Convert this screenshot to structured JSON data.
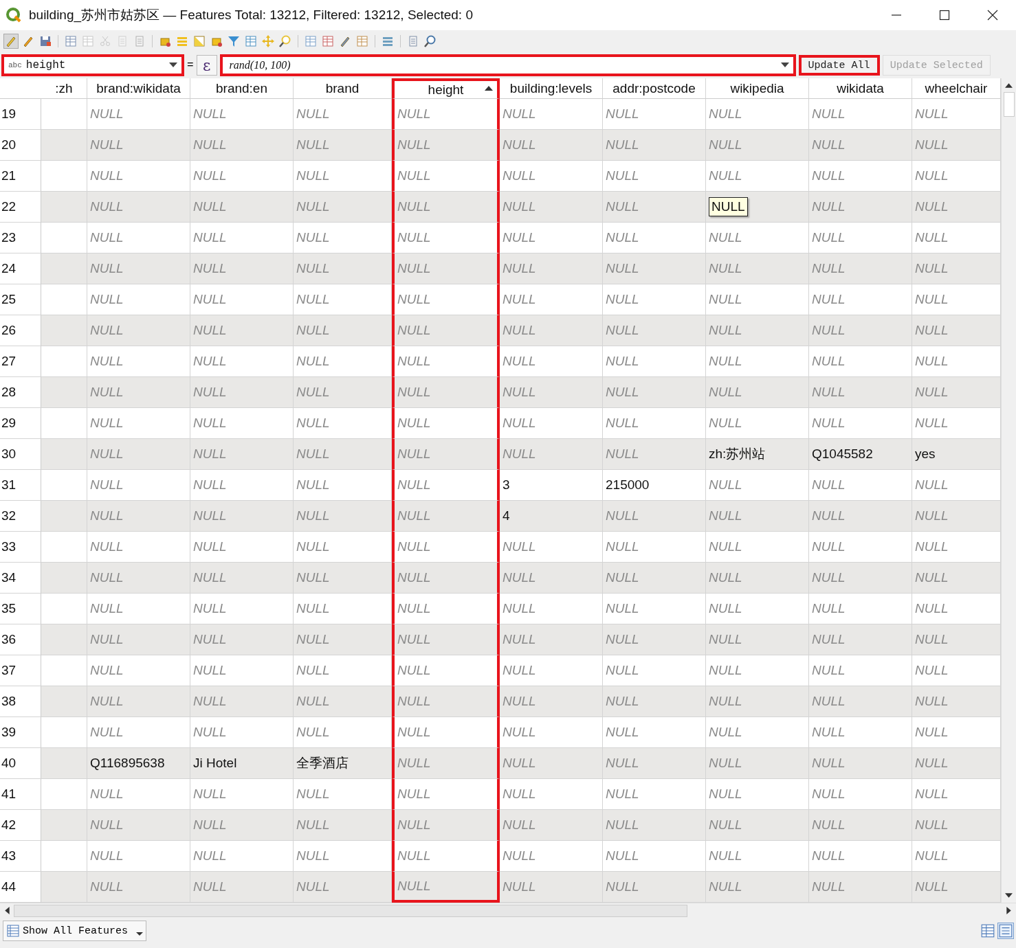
{
  "window": {
    "title": "building_苏州市姑苏区 — Features Total: 13212, Filtered: 13212, Selected: 0"
  },
  "field_calculator": {
    "field": {
      "type_label": "abc",
      "value": "height",
      "highlighted": true
    },
    "equals": "=",
    "expression_button": "ε",
    "expression": {
      "value": "rand(10, 100)",
      "highlighted": true
    },
    "buttons": [
      {
        "label": "Update All",
        "disabled": false,
        "highlighted": true
      },
      {
        "label": "Update Selected",
        "disabled": true,
        "highlighted": false
      }
    ]
  },
  "table": {
    "columns": [
      {
        "label": ":zh",
        "sorted": false,
        "highlighted": false
      },
      {
        "label": "brand:wikidata",
        "sorted": false,
        "highlighted": false
      },
      {
        "label": "brand:en",
        "sorted": false,
        "highlighted": false
      },
      {
        "label": "brand",
        "sorted": false,
        "highlighted": false
      },
      {
        "label": "height",
        "sorted": true,
        "highlighted": true
      },
      {
        "label": "building:levels",
        "sorted": false,
        "highlighted": false
      },
      {
        "label": "addr:postcode",
        "sorted": false,
        "highlighted": false
      },
      {
        "label": "wikipedia",
        "sorted": false,
        "highlighted": false
      },
      {
        "label": "wikidata",
        "sorted": false,
        "highlighted": false
      },
      {
        "label": "wheelchair",
        "sorted": false,
        "highlighted": false
      }
    ],
    "rows": [
      {
        "id": "19",
        "cells": [
          "",
          {
            "text": "NULL",
            "null": true
          },
          {
            "text": "NULL",
            "null": true
          },
          {
            "text": "NULL",
            "null": true
          },
          {
            "text": "NULL",
            "null": true
          },
          {
            "text": "NULL",
            "null": true
          },
          {
            "text": "NULL",
            "null": true
          },
          {
            "text": "NULL",
            "null": true
          },
          {
            "text": "NULL",
            "null": true
          },
          {
            "text": "NULL",
            "null": true
          }
        ]
      },
      {
        "id": "20",
        "cells": [
          "",
          {
            "text": "NULL",
            "null": true
          },
          {
            "text": "NULL",
            "null": true
          },
          {
            "text": "NULL",
            "null": true
          },
          {
            "text": "NULL",
            "null": true
          },
          {
            "text": "NULL",
            "null": true
          },
          {
            "text": "NULL",
            "null": true
          },
          {
            "text": "NULL",
            "null": true
          },
          {
            "text": "NULL",
            "null": true
          },
          {
            "text": "NULL",
            "null": true
          }
        ]
      },
      {
        "id": "21",
        "cells": [
          "",
          {
            "text": "NULL",
            "null": true
          },
          {
            "text": "NULL",
            "null": true
          },
          {
            "text": "NULL",
            "null": true
          },
          {
            "text": "NULL",
            "null": true
          },
          {
            "text": "NULL",
            "null": true
          },
          {
            "text": "NULL",
            "null": true
          },
          {
            "text": "NULL",
            "null": true
          },
          {
            "text": "NULL",
            "null": true
          },
          {
            "text": "NULL",
            "null": true
          }
        ]
      },
      {
        "id": "22",
        "cells": [
          "",
          {
            "text": "NULL",
            "null": true
          },
          {
            "text": "NULL",
            "null": true
          },
          {
            "text": "NULL",
            "null": true
          },
          {
            "text": "NULL",
            "null": true
          },
          {
            "text": "NULL",
            "null": true
          },
          {
            "text": "NULL",
            "null": true
          },
          {
            "kind": "tooltip",
            "text": "NULL"
          },
          {
            "text": "NULL",
            "null": true
          },
          {
            "text": "NULL",
            "null": true
          }
        ]
      },
      {
        "id": "23",
        "cells": [
          "",
          {
            "text": "NULL",
            "null": true
          },
          {
            "text": "NULL",
            "null": true
          },
          {
            "text": "NULL",
            "null": true
          },
          {
            "text": "NULL",
            "null": true
          },
          {
            "text": "NULL",
            "null": true
          },
          {
            "text": "NULL",
            "null": true
          },
          {
            "text": "NULL",
            "null": true
          },
          {
            "text": "NULL",
            "null": true
          },
          {
            "text": "NULL",
            "null": true
          }
        ]
      },
      {
        "id": "24",
        "cells": [
          "",
          {
            "text": "NULL",
            "null": true
          },
          {
            "text": "NULL",
            "null": true
          },
          {
            "text": "NULL",
            "null": true
          },
          {
            "text": "NULL",
            "null": true
          },
          {
            "text": "NULL",
            "null": true
          },
          {
            "text": "NULL",
            "null": true
          },
          {
            "text": "NULL",
            "null": true
          },
          {
            "text": "NULL",
            "null": true
          },
          {
            "text": "NULL",
            "null": true
          }
        ]
      },
      {
        "id": "25",
        "cells": [
          "",
          {
            "text": "NULL",
            "null": true
          },
          {
            "text": "NULL",
            "null": true
          },
          {
            "text": "NULL",
            "null": true
          },
          {
            "text": "NULL",
            "null": true
          },
          {
            "text": "NULL",
            "null": true
          },
          {
            "text": "NULL",
            "null": true
          },
          {
            "text": "NULL",
            "null": true
          },
          {
            "text": "NULL",
            "null": true
          },
          {
            "text": "NULL",
            "null": true
          }
        ]
      },
      {
        "id": "26",
        "cells": [
          "",
          {
            "text": "NULL",
            "null": true
          },
          {
            "text": "NULL",
            "null": true
          },
          {
            "text": "NULL",
            "null": true
          },
          {
            "text": "NULL",
            "null": true
          },
          {
            "text": "NULL",
            "null": true
          },
          {
            "text": "NULL",
            "null": true
          },
          {
            "text": "NULL",
            "null": true
          },
          {
            "text": "NULL",
            "null": true
          },
          {
            "text": "NULL",
            "null": true
          }
        ]
      },
      {
        "id": "27",
        "cells": [
          "",
          {
            "text": "NULL",
            "null": true
          },
          {
            "text": "NULL",
            "null": true
          },
          {
            "text": "NULL",
            "null": true
          },
          {
            "text": "NULL",
            "null": true
          },
          {
            "text": "NULL",
            "null": true
          },
          {
            "text": "NULL",
            "null": true
          },
          {
            "text": "NULL",
            "null": true
          },
          {
            "text": "NULL",
            "null": true
          },
          {
            "text": "NULL",
            "null": true
          }
        ]
      },
      {
        "id": "28",
        "cells": [
          "",
          {
            "text": "NULL",
            "null": true
          },
          {
            "text": "NULL",
            "null": true
          },
          {
            "text": "NULL",
            "null": true
          },
          {
            "text": "NULL",
            "null": true
          },
          {
            "text": "NULL",
            "null": true
          },
          {
            "text": "NULL",
            "null": true
          },
          {
            "text": "NULL",
            "null": true
          },
          {
            "text": "NULL",
            "null": true
          },
          {
            "text": "NULL",
            "null": true
          }
        ]
      },
      {
        "id": "29",
        "cells": [
          "",
          {
            "text": "NULL",
            "null": true
          },
          {
            "text": "NULL",
            "null": true
          },
          {
            "text": "NULL",
            "null": true
          },
          {
            "text": "NULL",
            "null": true
          },
          {
            "text": "NULL",
            "null": true
          },
          {
            "text": "NULL",
            "null": true
          },
          {
            "text": "NULL",
            "null": true
          },
          {
            "text": "NULL",
            "null": true
          },
          {
            "text": "NULL",
            "null": true
          }
        ]
      },
      {
        "id": "30",
        "cells": [
          "",
          {
            "text": "NULL",
            "null": true
          },
          {
            "text": "NULL",
            "null": true
          },
          {
            "text": "NULL",
            "null": true
          },
          {
            "text": "NULL",
            "null": true
          },
          {
            "text": "NULL",
            "null": true
          },
          {
            "text": "NULL",
            "null": true
          },
          {
            "text": "zh:苏州站",
            "null": false
          },
          {
            "text": "Q1045582",
            "null": false
          },
          {
            "text": "yes",
            "null": false
          }
        ]
      },
      {
        "id": "31",
        "cells": [
          "",
          {
            "text": "NULL",
            "null": true
          },
          {
            "text": "NULL",
            "null": true
          },
          {
            "text": "NULL",
            "null": true
          },
          {
            "text": "NULL",
            "null": true
          },
          {
            "text": "3",
            "null": false
          },
          {
            "text": "215000",
            "null": false
          },
          {
            "text": "NULL",
            "null": true
          },
          {
            "text": "NULL",
            "null": true
          },
          {
            "text": "NULL",
            "null": true
          }
        ]
      },
      {
        "id": "32",
        "cells": [
          "",
          {
            "text": "NULL",
            "null": true
          },
          {
            "text": "NULL",
            "null": true
          },
          {
            "text": "NULL",
            "null": true
          },
          {
            "text": "NULL",
            "null": true
          },
          {
            "text": "4",
            "null": false
          },
          {
            "text": "NULL",
            "null": true
          },
          {
            "text": "NULL",
            "null": true
          },
          {
            "text": "NULL",
            "null": true
          },
          {
            "text": "NULL",
            "null": true
          }
        ]
      },
      {
        "id": "33",
        "cells": [
          "",
          {
            "text": "NULL",
            "null": true
          },
          {
            "text": "NULL",
            "null": true
          },
          {
            "text": "NULL",
            "null": true
          },
          {
            "text": "NULL",
            "null": true
          },
          {
            "text": "NULL",
            "null": true
          },
          {
            "text": "NULL",
            "null": true
          },
          {
            "text": "NULL",
            "null": true
          },
          {
            "text": "NULL",
            "null": true
          },
          {
            "text": "NULL",
            "null": true
          }
        ]
      },
      {
        "id": "34",
        "cells": [
          "",
          {
            "text": "NULL",
            "null": true
          },
          {
            "text": "NULL",
            "null": true
          },
          {
            "text": "NULL",
            "null": true
          },
          {
            "text": "NULL",
            "null": true
          },
          {
            "text": "NULL",
            "null": true
          },
          {
            "text": "NULL",
            "null": true
          },
          {
            "text": "NULL",
            "null": true
          },
          {
            "text": "NULL",
            "null": true
          },
          {
            "text": "NULL",
            "null": true
          }
        ]
      },
      {
        "id": "35",
        "cells": [
          "",
          {
            "text": "NULL",
            "null": true
          },
          {
            "text": "NULL",
            "null": true
          },
          {
            "text": "NULL",
            "null": true
          },
          {
            "text": "NULL",
            "null": true
          },
          {
            "text": "NULL",
            "null": true
          },
          {
            "text": "NULL",
            "null": true
          },
          {
            "text": "NULL",
            "null": true
          },
          {
            "text": "NULL",
            "null": true
          },
          {
            "text": "NULL",
            "null": true
          }
        ]
      },
      {
        "id": "36",
        "cells": [
          "",
          {
            "text": "NULL",
            "null": true
          },
          {
            "text": "NULL",
            "null": true
          },
          {
            "text": "NULL",
            "null": true
          },
          {
            "text": "NULL",
            "null": true
          },
          {
            "text": "NULL",
            "null": true
          },
          {
            "text": "NULL",
            "null": true
          },
          {
            "text": "NULL",
            "null": true
          },
          {
            "text": "NULL",
            "null": true
          },
          {
            "text": "NULL",
            "null": true
          }
        ]
      },
      {
        "id": "37",
        "cells": [
          "",
          {
            "text": "NULL",
            "null": true
          },
          {
            "text": "NULL",
            "null": true
          },
          {
            "text": "NULL",
            "null": true
          },
          {
            "text": "NULL",
            "null": true
          },
          {
            "text": "NULL",
            "null": true
          },
          {
            "text": "NULL",
            "null": true
          },
          {
            "text": "NULL",
            "null": true
          },
          {
            "text": "NULL",
            "null": true
          },
          {
            "text": "NULL",
            "null": true
          }
        ]
      },
      {
        "id": "38",
        "cells": [
          "",
          {
            "text": "NULL",
            "null": true
          },
          {
            "text": "NULL",
            "null": true
          },
          {
            "text": "NULL",
            "null": true
          },
          {
            "text": "NULL",
            "null": true
          },
          {
            "text": "NULL",
            "null": true
          },
          {
            "text": "NULL",
            "null": true
          },
          {
            "text": "NULL",
            "null": true
          },
          {
            "text": "NULL",
            "null": true
          },
          {
            "text": "NULL",
            "null": true
          }
        ]
      },
      {
        "id": "39",
        "cells": [
          "",
          {
            "text": "NULL",
            "null": true
          },
          {
            "text": "NULL",
            "null": true
          },
          {
            "text": "NULL",
            "null": true
          },
          {
            "text": "NULL",
            "null": true
          },
          {
            "text": "NULL",
            "null": true
          },
          {
            "text": "NULL",
            "null": true
          },
          {
            "text": "NULL",
            "null": true
          },
          {
            "text": "NULL",
            "null": true
          },
          {
            "text": "NULL",
            "null": true
          }
        ]
      },
      {
        "id": "40",
        "cells": [
          "",
          {
            "text": "Q116895638",
            "null": false
          },
          {
            "text": "Ji Hotel",
            "null": false
          },
          {
            "text": "全季酒店",
            "null": false
          },
          {
            "text": "NULL",
            "null": true
          },
          {
            "text": "NULL",
            "null": true
          },
          {
            "text": "NULL",
            "null": true
          },
          {
            "text": "NULL",
            "null": true
          },
          {
            "text": "NULL",
            "null": true
          },
          {
            "text": "NULL",
            "null": true
          }
        ]
      },
      {
        "id": "41",
        "cells": [
          "",
          {
            "text": "NULL",
            "null": true
          },
          {
            "text": "NULL",
            "null": true
          },
          {
            "text": "NULL",
            "null": true
          },
          {
            "text": "NULL",
            "null": true
          },
          {
            "text": "NULL",
            "null": true
          },
          {
            "text": "NULL",
            "null": true
          },
          {
            "text": "NULL",
            "null": true
          },
          {
            "text": "NULL",
            "null": true
          },
          {
            "text": "NULL",
            "null": true
          }
        ]
      },
      {
        "id": "42",
        "cells": [
          "",
          {
            "text": "NULL",
            "null": true
          },
          {
            "text": "NULL",
            "null": true
          },
          {
            "text": "NULL",
            "null": true
          },
          {
            "text": "NULL",
            "null": true
          },
          {
            "text": "NULL",
            "null": true
          },
          {
            "text": "NULL",
            "null": true
          },
          {
            "text": "NULL",
            "null": true
          },
          {
            "text": "NULL",
            "null": true
          },
          {
            "text": "NULL",
            "null": true
          }
        ]
      },
      {
        "id": "43",
        "cells": [
          "",
          {
            "text": "NULL",
            "null": true
          },
          {
            "text": "NULL",
            "null": true
          },
          {
            "text": "NULL",
            "null": true
          },
          {
            "text": "NULL",
            "null": true
          },
          {
            "text": "NULL",
            "null": true
          },
          {
            "text": "NULL",
            "null": true
          },
          {
            "text": "NULL",
            "null": true
          },
          {
            "text": "NULL",
            "null": true
          },
          {
            "text": "NULL",
            "null": true
          }
        ]
      },
      {
        "id": "44",
        "cells": [
          "",
          {
            "text": "NULL",
            "null": true
          },
          {
            "text": "NULL",
            "null": true
          },
          {
            "text": "NULL",
            "null": true
          },
          {
            "text": "NULL",
            "null": true
          },
          {
            "text": "NULL",
            "null": true
          },
          {
            "text": "NULL",
            "null": true
          },
          {
            "text": "NULL",
            "null": true
          },
          {
            "text": "NULL",
            "null": true
          },
          {
            "text": "NULL",
            "null": true
          }
        ]
      }
    ]
  },
  "footer": {
    "filter_button": "Show All Features"
  }
}
